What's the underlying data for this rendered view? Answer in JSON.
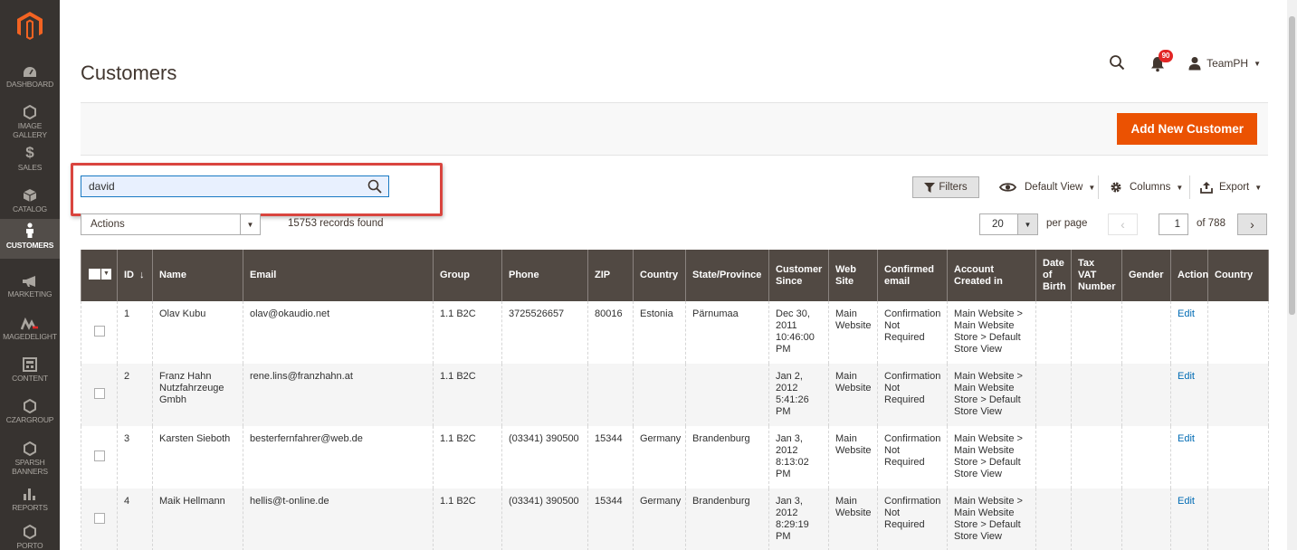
{
  "sidebar": {
    "items": [
      {
        "label": "DASHBOARD",
        "icon": "dashboard-icon"
      },
      {
        "label": "IMAGE GALLERY",
        "icon": "hexagon-icon"
      },
      {
        "label": "SALES",
        "icon": "dollar-icon"
      },
      {
        "label": "CATALOG",
        "icon": "box-icon"
      },
      {
        "label": "CUSTOMERS",
        "icon": "person-icon",
        "active": true
      },
      {
        "label": "MARKETING",
        "icon": "megaphone-icon"
      },
      {
        "label": "MAGEDELIGHT",
        "icon": "magedelight-icon"
      },
      {
        "label": "CONTENT",
        "icon": "layout-icon"
      },
      {
        "label": "CZARGROUP",
        "icon": "hexagon-icon"
      },
      {
        "label": "SPARSH BANNERS",
        "icon": "hexagon-icon"
      },
      {
        "label": "REPORTS",
        "icon": "bar-chart-icon"
      },
      {
        "label": "PORTO",
        "icon": "hexagon-icon"
      }
    ]
  },
  "header": {
    "title": "Customers",
    "notification_count": "90",
    "user_name": "TeamPH"
  },
  "page_actions": {
    "add_new_label": "Add New Customer"
  },
  "search": {
    "value": "david"
  },
  "toolbar": {
    "filters_label": "Filters",
    "view_label": "Default View",
    "columns_label": "Columns",
    "export_label": "Export",
    "actions_label": "Actions",
    "records_found": "15753 records found",
    "per_page_value": "20",
    "per_page_label": "per page",
    "current_page": "1",
    "total_pages": "of 788"
  },
  "grid": {
    "columns": [
      "ID",
      "Name",
      "Email",
      "Group",
      "Phone",
      "ZIP",
      "Country",
      "State/Province",
      "Customer Since",
      "Web Site",
      "Confirmed email",
      "Account Created in",
      "Date of Birth",
      "Tax VAT Number",
      "Gender",
      "Action",
      "Country"
    ],
    "sort_indicator": "↓",
    "rows": [
      {
        "id": "1",
        "name": "Olav Kubu",
        "email": "olav@okaudio.net",
        "group": "1.1 B2C",
        "phone": "3725526657",
        "zip": "80016",
        "country": "Estonia",
        "state": "Pärnumaa",
        "since": "Dec 30, 2011 10:46:00 PM",
        "website": "Main Website",
        "confirmed": "Confirmation Not Required",
        "created_in": "Main Website > Main Website Store > Default Store View",
        "dob": "",
        "taxvat": "",
        "gender": "",
        "action": "Edit",
        "country2": ""
      },
      {
        "id": "2",
        "name": "Franz Hahn Nutzfahrzeuge Gmbh",
        "email": "rene.lins@franzhahn.at",
        "group": "1.1 B2C",
        "phone": "",
        "zip": "",
        "country": "",
        "state": "",
        "since": "Jan 2, 2012 5:41:26 PM",
        "website": "Main Website",
        "confirmed": "Confirmation Not Required",
        "created_in": "Main Website > Main Website Store > Default Store View",
        "dob": "",
        "taxvat": "",
        "gender": "",
        "action": "Edit",
        "country2": ""
      },
      {
        "id": "3",
        "name": "Karsten Sieboth",
        "email": "besterfernfahrer@web.de",
        "group": "1.1 B2C",
        "phone": "(03341) 390500",
        "zip": "15344",
        "country": "Germany",
        "state": "Brandenburg",
        "since": "Jan 3, 2012 8:13:02 PM",
        "website": "Main Website",
        "confirmed": "Confirmation Not Required",
        "created_in": "Main Website > Main Website Store > Default Store View",
        "dob": "",
        "taxvat": "",
        "gender": "",
        "action": "Edit",
        "country2": ""
      },
      {
        "id": "4",
        "name": "Maik Hellmann",
        "email": "hellis@t-online.de",
        "group": "1.1 B2C",
        "phone": "(03341) 390500",
        "zip": "15344",
        "country": "Germany",
        "state": "Brandenburg",
        "since": "Jan 3, 2012 8:29:19 PM",
        "website": "Main Website",
        "confirmed": "Confirmation Not Required",
        "created_in": "Main Website > Main Website Store > Default Store View",
        "dob": "",
        "taxvat": "",
        "gender": "",
        "action": "Edit",
        "country2": ""
      }
    ]
  },
  "colors": {
    "sidebar_bg": "#373330",
    "accent": "#eb5202",
    "grid_header": "#514943",
    "highlight": "#d9453f",
    "link": "#006bb4"
  }
}
